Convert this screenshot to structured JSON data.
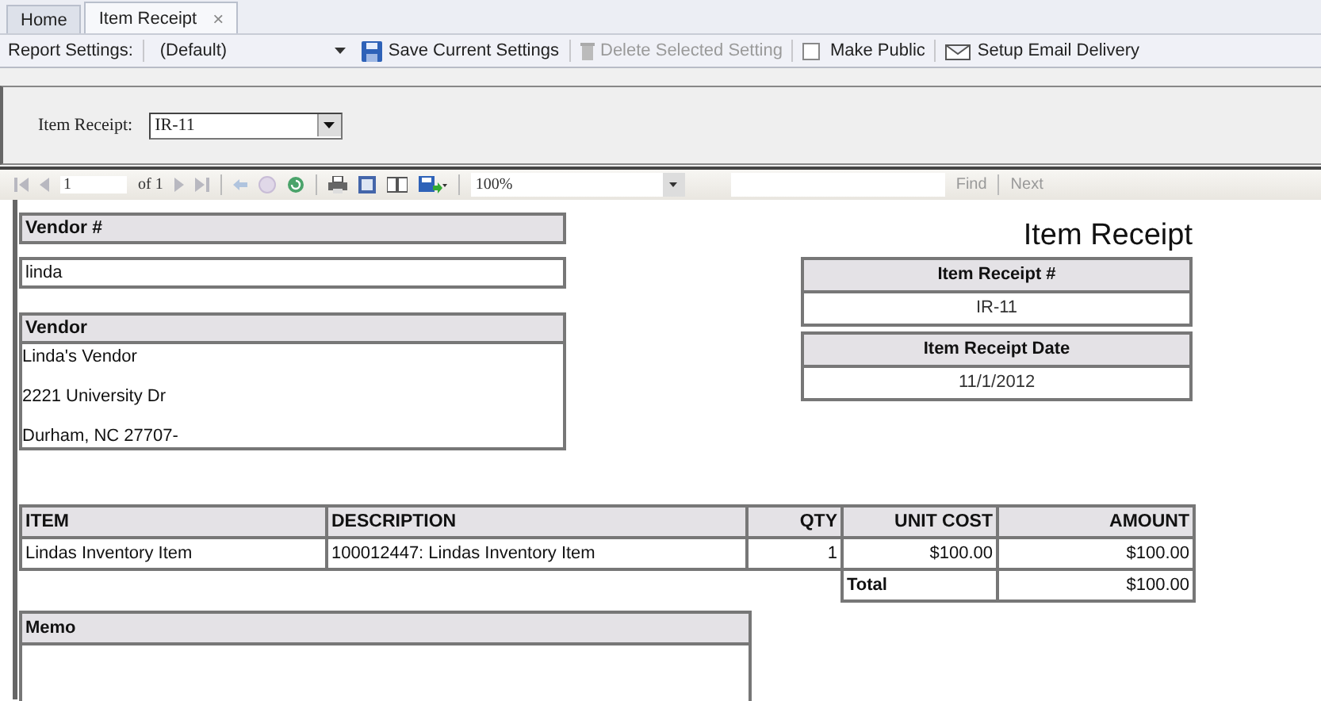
{
  "tabs": [
    {
      "label": "Home",
      "selected": false
    },
    {
      "label": "Item Receipt",
      "selected": true,
      "close": "×"
    }
  ],
  "report_settings": {
    "label": "Report Settings:",
    "value": "(Default)",
    "actions": [
      {
        "kind": "save",
        "label": "Save Current Settings",
        "disabled": false
      },
      {
        "kind": "delete",
        "label": "Delete Selected Setting",
        "disabled": true
      },
      {
        "kind": "checkbox",
        "label": "Make Public",
        "checked": false
      },
      {
        "kind": "email",
        "label": "Setup Email Delivery"
      }
    ]
  },
  "parameters": [
    {
      "label": "Item Receipt:",
      "value": "IR-11"
    }
  ],
  "viewer_toolbar": {
    "page": "1",
    "of": "of 1",
    "zoom": "100%",
    "find": "Find",
    "next": "Next"
  },
  "report": {
    "title": "Item Receipt",
    "vendor_number": {
      "header": "Vendor #",
      "value": "linda"
    },
    "vendor": {
      "header": "Vendor",
      "lines": [
        "Linda's Vendor",
        "2221 University Dr",
        "Durham, NC 27707-"
      ]
    },
    "receipt_number": {
      "header": "Item Receipt #",
      "value": "IR-11"
    },
    "receipt_date": {
      "header": "Item Receipt Date",
      "value": "11/1/2012"
    },
    "table": {
      "columns": [
        {
          "label": "ITEM",
          "kind": "text"
        },
        {
          "label": "DESCRIPTION",
          "kind": "text"
        },
        {
          "label": "QTY",
          "kind": "number"
        },
        {
          "label": "UNIT COST",
          "kind": "number"
        },
        {
          "label": "AMOUNT",
          "kind": "number"
        }
      ],
      "rows": [
        [
          "Lindas Inventory Item",
          "100012447: Lindas Inventory Item",
          "1",
          "$100.00",
          "$100.00"
        ]
      ]
    },
    "total": {
      "label": "Total",
      "value": "$100.00"
    },
    "memo": {
      "header": "Memo"
    }
  }
}
